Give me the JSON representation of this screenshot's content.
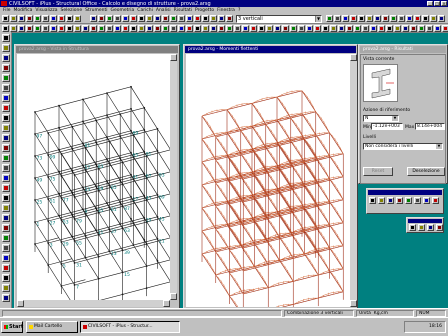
{
  "app": {
    "title": "CIVILSOFT - iPlus - Structural Office - Calcolo e disegno di strutture - prova2.arsg",
    "menu": [
      "File",
      "Modifica",
      "Visualizza",
      "Selezione",
      "Strumenti",
      "Geometria",
      "Carichi",
      "Analisi",
      "Risultati",
      "Progetto",
      "Finestra",
      "?"
    ]
  },
  "toolbar": {
    "view_select": "3 verticali"
  },
  "windows": {
    "left": {
      "title": "prova2.arsg - Vista in Struttura"
    },
    "center": {
      "title": "prova2.arsg - Momenti flettenti"
    },
    "right": {
      "title": "prova2.arsg - Risultati"
    }
  },
  "results_panel": {
    "section_label": "Vista corrente",
    "azione_label": "Azione di riferimento",
    "azione_value": "N",
    "min_label": "Min.",
    "min_value": "-1.12e+003",
    "max_label": "Max",
    "max_value": "8.14e+004",
    "livelli_label": "Livelli",
    "livelli_value": "Non considera i livelli",
    "btn_reset": "Reset",
    "btn_deselect": "Deselezione"
  },
  "status": {
    "combination": "Combinazione 3 verticali",
    "units_label": "Unità",
    "units_value": "Kg,cm",
    "num": "NUM"
  },
  "taskbar": {
    "start": "Start",
    "items": [
      "Mail Cartello",
      "CIVILSOFT - iPlus - Structur..."
    ],
    "clock": "18:16"
  },
  "node_labels": [
    "1",
    "3",
    "5",
    "7",
    "9",
    "11",
    "13",
    "15",
    "17",
    "19",
    "21",
    "23",
    "25",
    "27",
    "29",
    "31",
    "33",
    "35",
    "37",
    "39",
    "41",
    "43",
    "45",
    "47",
    "49",
    "51",
    "53",
    "55",
    "57",
    "59",
    "61",
    "63",
    "65",
    "67",
    "69",
    "71",
    "73",
    "75",
    "77",
    "79",
    "81",
    "83",
    "85",
    "87",
    "89",
    "91",
    "93",
    "95",
    "97",
    "99"
  ],
  "colors": {
    "desktop": "#008080",
    "titlebar_active": "#000080",
    "titlebar_inactive": "#808080",
    "frame_left": "#1a1a1a",
    "label_left": "#007a7a",
    "frame_center": "#a0301a",
    "diagram_center": "#d46a3a"
  },
  "icons": [
    "app-icon",
    "minimize-icon",
    "maximize-icon",
    "close-icon",
    "new-icon",
    "open-icon",
    "save-icon",
    "print-icon",
    "cut-icon",
    "copy-icon",
    "paste-icon",
    "undo-icon",
    "zoom-icon",
    "rotate-icon",
    "select-icon",
    "node-icon",
    "beam-icon",
    "load-icon",
    "windows-logo-icon"
  ]
}
